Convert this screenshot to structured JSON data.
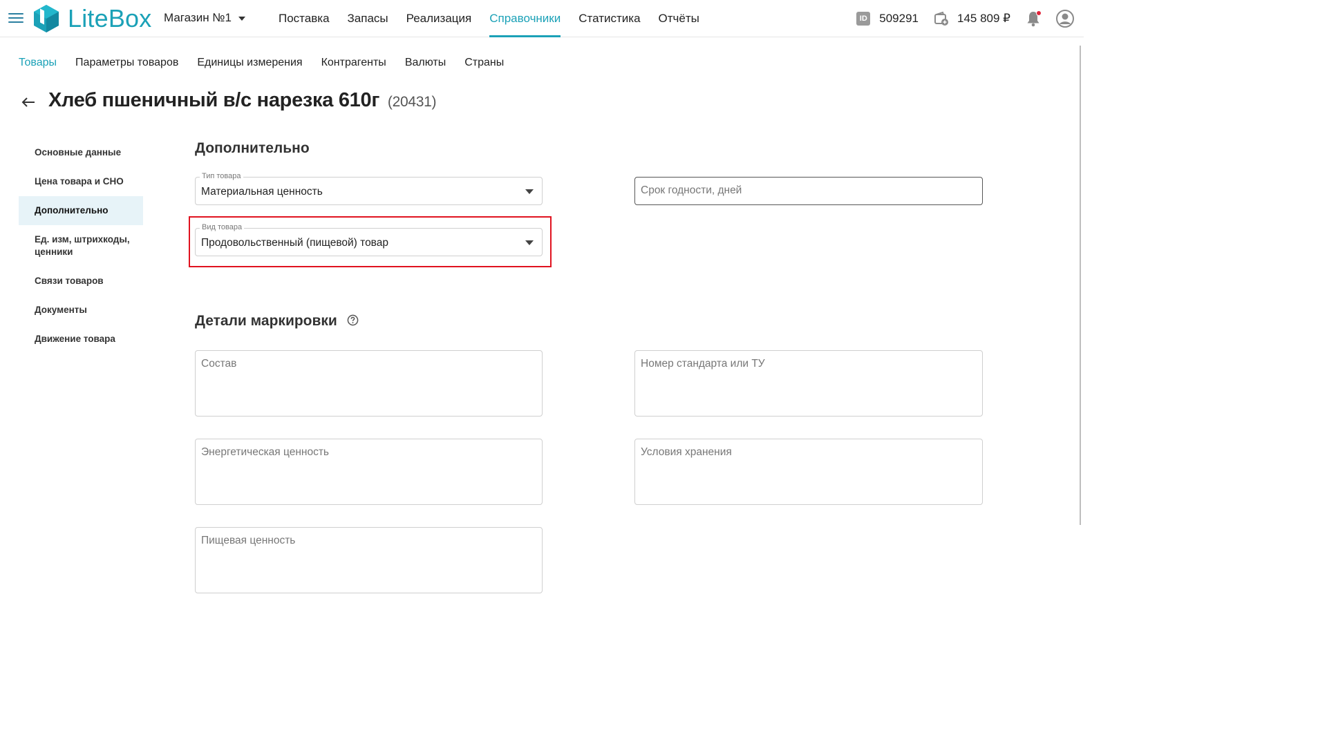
{
  "app": {
    "logo_text": "LiteBox",
    "store_name": "Магазин №1"
  },
  "main_nav": [
    {
      "label": "Поставка",
      "active": false
    },
    {
      "label": "Запасы",
      "active": false
    },
    {
      "label": "Реализация",
      "active": false
    },
    {
      "label": "Справочники",
      "active": true
    },
    {
      "label": "Статистика",
      "active": false
    },
    {
      "label": "Отчёты",
      "active": false
    }
  ],
  "account": {
    "id_badge": "ID",
    "id_value": "509291",
    "balance": "145 809 ₽",
    "has_notifications": true
  },
  "sub_nav": [
    {
      "label": "Товары",
      "active": true
    },
    {
      "label": "Параметры товаров",
      "active": false
    },
    {
      "label": "Единицы измерения",
      "active": false
    },
    {
      "label": "Контрагенты",
      "active": false
    },
    {
      "label": "Валюты",
      "active": false
    },
    {
      "label": "Страны",
      "active": false
    }
  ],
  "page": {
    "back_icon": "arrow-left-icon",
    "title": "Хлеб пшеничный в/с нарезка 610г",
    "code": "(20431)"
  },
  "side_menu": [
    {
      "label": "Основные данные",
      "active": false
    },
    {
      "label": "Цена товара и СНО",
      "active": false
    },
    {
      "label": "Дополнительно",
      "active": true
    },
    {
      "label": "Ед. изм, штрихкоды, ценники",
      "active": false
    },
    {
      "label": "Связи товаров",
      "active": false
    },
    {
      "label": "Документы",
      "active": false
    },
    {
      "label": "Движение товара",
      "active": false
    }
  ],
  "additional": {
    "title": "Дополнительно",
    "product_type": {
      "label": "Тип товара",
      "value": "Материальная ценность"
    },
    "product_kind": {
      "label": "Вид товара",
      "value": "Продовольственный (пищевой) товар"
    },
    "shelf_life": {
      "placeholder": "Срок годности, дней"
    }
  },
  "marking": {
    "title": "Детали маркировки",
    "composition": {
      "placeholder": "Состав"
    },
    "standard": {
      "placeholder": "Номер стандарта или ТУ"
    },
    "energy": {
      "placeholder": "Энергетическая ценность"
    },
    "storage": {
      "placeholder": "Условия хранения"
    },
    "nutrition": {
      "placeholder": "Пищевая ценность"
    }
  },
  "colors": {
    "accent": "#1ba1b7",
    "highlight": "#e0121f",
    "notification_dot": "#e0243a",
    "active_menu_bg": "#e7f3f8"
  }
}
